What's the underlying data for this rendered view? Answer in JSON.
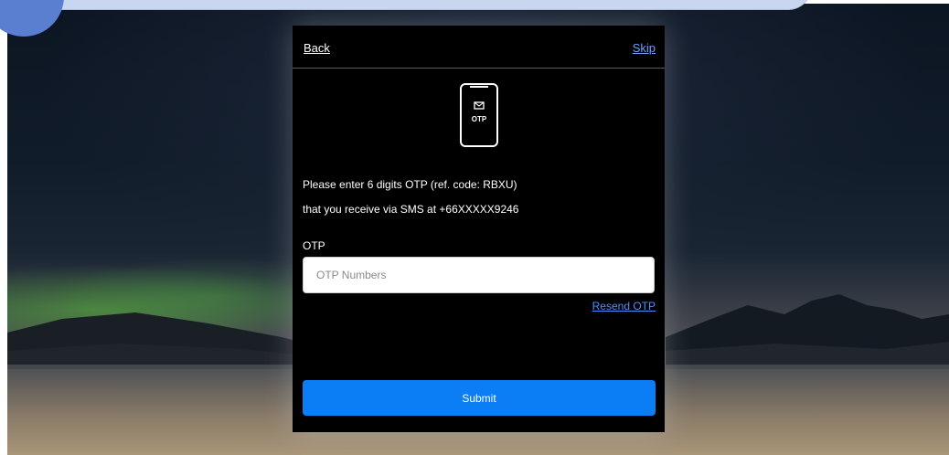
{
  "header": {
    "back_label": "Back",
    "skip_label": "Skip"
  },
  "icon": {
    "name": "otp-phone-icon",
    "label": "OTP"
  },
  "message": {
    "line1": "Please enter 6 digits OTP (ref. code: RBXU)",
    "line2": "that you receive via SMS at +66XXXXX9246"
  },
  "otp": {
    "label": "OTP",
    "placeholder": "OTP Numbers",
    "value": ""
  },
  "resend_label": "Resend OTP",
  "submit_label": "Submit",
  "colors": {
    "modal_bg": "#000000",
    "link_blue": "#4a90ff",
    "submit_blue": "#0b7ef5",
    "banner": "#c9d6f0",
    "circle": "#5a7fd0"
  }
}
